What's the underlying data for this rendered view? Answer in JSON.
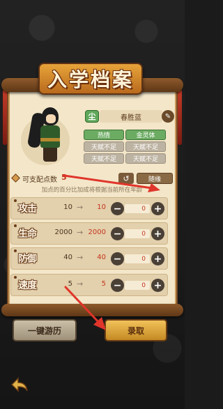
{
  "header": {
    "title": "入学档案"
  },
  "character": {
    "soul_tag": "尘",
    "name": "春胜蓝",
    "traits": [
      "热情",
      "金灵体",
      "天赋不足",
      "天赋不足",
      "天赋不足",
      "天赋不足"
    ]
  },
  "points": {
    "label": "可支配点数",
    "value": "5",
    "random_label": "随缘",
    "reset_glyph": "↺",
    "hint": "加点的百分比加成将根据当前所在年龄"
  },
  "stats": [
    {
      "name": "攻击",
      "current": "10",
      "arrow": "→",
      "new": "10",
      "alloc": "0",
      "minus": "−",
      "plus": "+"
    },
    {
      "name": "生命",
      "current": "2000",
      "arrow": "→",
      "new": "2000",
      "alloc": "0",
      "minus": "−",
      "plus": "+"
    },
    {
      "name": "防御",
      "current": "40",
      "arrow": "→",
      "new": "40",
      "alloc": "0",
      "minus": "−",
      "plus": "+"
    },
    {
      "name": "速度",
      "current": "5",
      "arrow": "→",
      "new": "5",
      "alloc": "0",
      "minus": "−",
      "plus": "+"
    }
  ],
  "buttons": {
    "travel": "一键游历",
    "enroll": "录取"
  },
  "icons": {
    "edit": "pencil-icon",
    "back": "back-arrow-icon",
    "reset": "reset-icon"
  },
  "colors": {
    "accent": "#f2c25a",
    "highlight_red": "#c4361f",
    "trait_green": "#6bab62"
  }
}
